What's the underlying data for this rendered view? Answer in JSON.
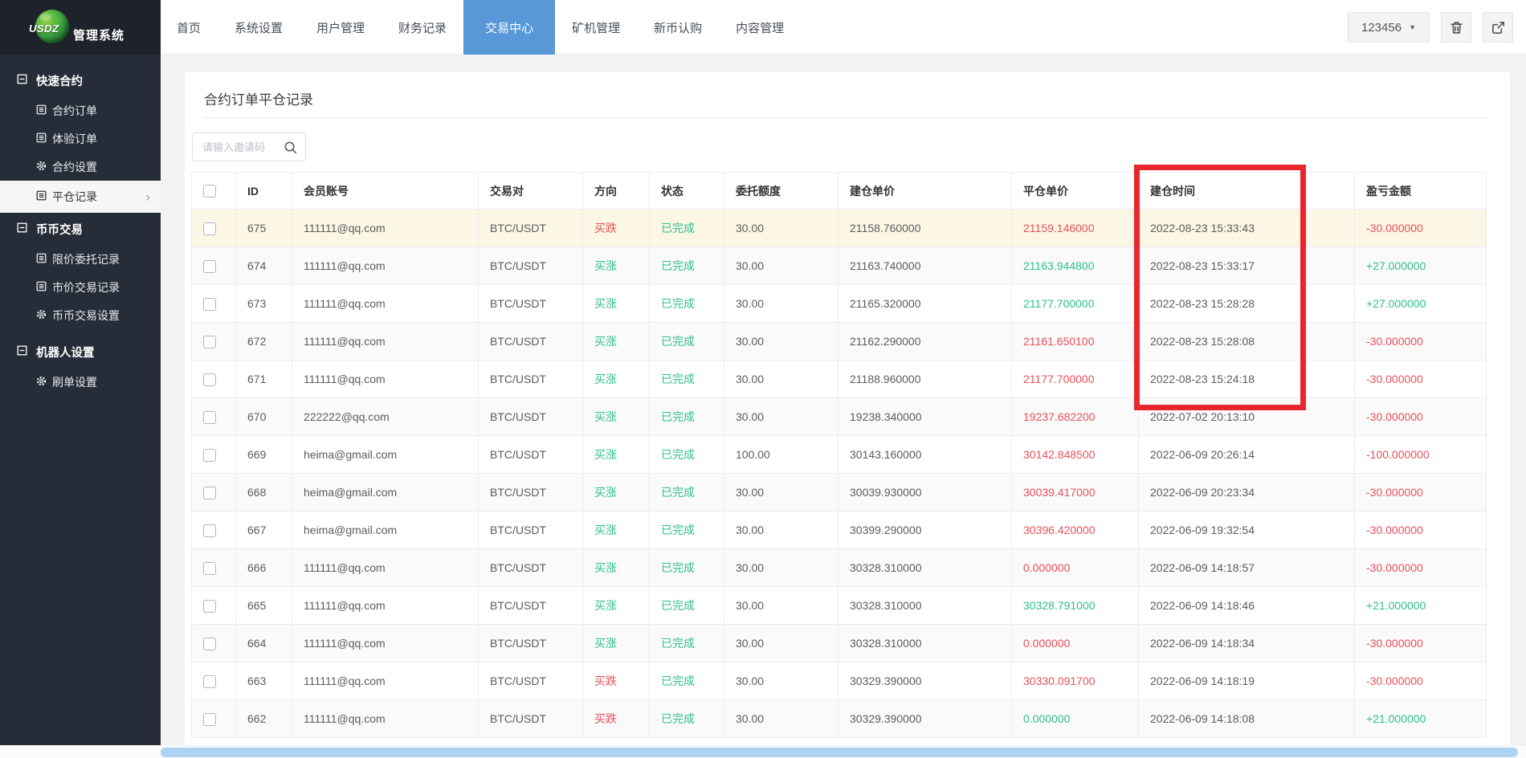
{
  "theme": {
    "accent_blue": "#5898d9",
    "red": "#e7515a",
    "green": "#2ebf8d",
    "annotation_red": "#e8262d",
    "sidebar_bg": "#272d38",
    "logo_bg": "#1e232b",
    "highlight_row": "#fcf6e5",
    "scrollbar_thumb": "#aed3f2"
  },
  "header": {
    "logo": {
      "brand": "USDZ",
      "title": "管理系统",
      "icon": "globe-icon"
    },
    "nav": [
      {
        "label": "首页",
        "active": false
      },
      {
        "label": "系统设置",
        "active": false
      },
      {
        "label": "用户管理",
        "active": false
      },
      {
        "label": "财务记录",
        "active": false
      },
      {
        "label": "交易中心",
        "active": true
      },
      {
        "label": "矿机管理",
        "active": false
      },
      {
        "label": "新币认购",
        "active": false
      },
      {
        "label": "内容管理",
        "active": false
      }
    ],
    "right": {
      "dropdown_label": "123456",
      "caret_icon": "caret-down-icon",
      "icons": [
        "trash-icon",
        "logout-icon"
      ]
    }
  },
  "sidebar": {
    "sections": [
      {
        "title": "快速合约",
        "icon": "collapse-icon",
        "items": [
          {
            "label": "合约订单",
            "icon": "list-icon",
            "active": false
          },
          {
            "label": "体验订单",
            "icon": "list-icon",
            "active": false
          },
          {
            "label": "合约设置",
            "icon": "gear-icon",
            "active": false
          },
          {
            "label": "平仓记录",
            "icon": "list-icon",
            "active": true
          }
        ]
      },
      {
        "title": "币币交易",
        "icon": "collapse-icon",
        "items": [
          {
            "label": "限价委托记录",
            "icon": "list-icon",
            "active": false
          },
          {
            "label": "市价交易记录",
            "icon": "list-icon",
            "active": false
          },
          {
            "label": "币币交易设置",
            "icon": "gear-icon",
            "active": false
          }
        ]
      },
      {
        "title": "机器人设置",
        "icon": "collapse-icon",
        "items": [
          {
            "label": "刷单设置",
            "icon": "gear-icon",
            "active": false
          }
        ]
      }
    ]
  },
  "main": {
    "page_title": "合约订单平仓记录",
    "search": {
      "placeholder": "请输入邀请码",
      "icon": "search-icon"
    },
    "table": {
      "columns": [
        "ID",
        "会员账号",
        "交易对",
        "方向",
        "状态",
        "委托额度",
        "建仓单价",
        "平仓单价",
        "建仓时间",
        "盈亏金额"
      ],
      "rows": [
        {
          "id": "675",
          "account": "111111@qq.com",
          "pair": "BTC/USDT",
          "direction": "买跌",
          "direction_color": "red",
          "status": "已完成",
          "amount": "30.00",
          "open_price": "21158.760000",
          "close_price": "21159.146000",
          "close_price_color": "red",
          "open_time": "2022-08-23 15:33:43",
          "profit": "-30.000000",
          "profit_color": "red",
          "highlight": true
        },
        {
          "id": "674",
          "account": "111111@qq.com",
          "pair": "BTC/USDT",
          "direction": "买涨",
          "direction_color": "green",
          "status": "已完成",
          "amount": "30.00",
          "open_price": "21163.740000",
          "close_price": "21163.944800",
          "close_price_color": "green",
          "open_time": "2022-08-23 15:33:17",
          "profit": "+27.000000",
          "profit_color": "green"
        },
        {
          "id": "673",
          "account": "111111@qq.com",
          "pair": "BTC/USDT",
          "direction": "买涨",
          "direction_color": "green",
          "status": "已完成",
          "amount": "30.00",
          "open_price": "21165.320000",
          "close_price": "21177.700000",
          "close_price_color": "green",
          "open_time": "2022-08-23 15:28:28",
          "profit": "+27.000000",
          "profit_color": "green"
        },
        {
          "id": "672",
          "account": "111111@qq.com",
          "pair": "BTC/USDT",
          "direction": "买涨",
          "direction_color": "green",
          "status": "已完成",
          "amount": "30.00",
          "open_price": "21162.290000",
          "close_price": "21161.650100",
          "close_price_color": "red",
          "open_time": "2022-08-23 15:28:08",
          "profit": "-30.000000",
          "profit_color": "red"
        },
        {
          "id": "671",
          "account": "111111@qq.com",
          "pair": "BTC/USDT",
          "direction": "买涨",
          "direction_color": "green",
          "status": "已完成",
          "amount": "30.00",
          "open_price": "21188.960000",
          "close_price": "21177.700000",
          "close_price_color": "red",
          "open_time": "2022-08-23 15:24:18",
          "profit": "-30.000000",
          "profit_color": "red"
        },
        {
          "id": "670",
          "account": "222222@qq.com",
          "pair": "BTC/USDT",
          "direction": "买涨",
          "direction_color": "green",
          "status": "已完成",
          "amount": "30.00",
          "open_price": "19238.340000",
          "close_price": "19237.682200",
          "close_price_color": "red",
          "open_time": "2022-07-02 20:13:10",
          "profit": "-30.000000",
          "profit_color": "red"
        },
        {
          "id": "669",
          "account": "heima@gmail.com",
          "pair": "BTC/USDT",
          "direction": "买涨",
          "direction_color": "green",
          "status": "已完成",
          "amount": "100.00",
          "open_price": "30143.160000",
          "close_price": "30142.848500",
          "close_price_color": "red",
          "open_time": "2022-06-09 20:26:14",
          "profit": "-100.000000",
          "profit_color": "red"
        },
        {
          "id": "668",
          "account": "heima@gmail.com",
          "pair": "BTC/USDT",
          "direction": "买涨",
          "direction_color": "green",
          "status": "已完成",
          "amount": "30.00",
          "open_price": "30039.930000",
          "close_price": "30039.417000",
          "close_price_color": "red",
          "open_time": "2022-06-09 20:23:34",
          "profit": "-30.000000",
          "profit_color": "red"
        },
        {
          "id": "667",
          "account": "heima@gmail.com",
          "pair": "BTC/USDT",
          "direction": "买涨",
          "direction_color": "green",
          "status": "已完成",
          "amount": "30.00",
          "open_price": "30399.290000",
          "close_price": "30396.420000",
          "close_price_color": "red",
          "open_time": "2022-06-09 19:32:54",
          "profit": "-30.000000",
          "profit_color": "red"
        },
        {
          "id": "666",
          "account": "111111@qq.com",
          "pair": "BTC/USDT",
          "direction": "买涨",
          "direction_color": "green",
          "status": "已完成",
          "amount": "30.00",
          "open_price": "30328.310000",
          "close_price": "0.000000",
          "close_price_color": "red",
          "open_time": "2022-06-09 14:18:57",
          "profit": "-30.000000",
          "profit_color": "red"
        },
        {
          "id": "665",
          "account": "111111@qq.com",
          "pair": "BTC/USDT",
          "direction": "买涨",
          "direction_color": "green",
          "status": "已完成",
          "amount": "30.00",
          "open_price": "30328.310000",
          "close_price": "30328.791000",
          "close_price_color": "green",
          "open_time": "2022-06-09 14:18:46",
          "profit": "+21.000000",
          "profit_color": "green"
        },
        {
          "id": "664",
          "account": "111111@qq.com",
          "pair": "BTC/USDT",
          "direction": "买涨",
          "direction_color": "green",
          "status": "已完成",
          "amount": "30.00",
          "open_price": "30328.310000",
          "close_price": "0.000000",
          "close_price_color": "red",
          "open_time": "2022-06-09 14:18:34",
          "profit": "-30.000000",
          "profit_color": "red"
        },
        {
          "id": "663",
          "account": "111111@qq.com",
          "pair": "BTC/USDT",
          "direction": "买跌",
          "direction_color": "red",
          "status": "已完成",
          "amount": "30.00",
          "open_price": "30329.390000",
          "close_price": "30330.091700",
          "close_price_color": "red",
          "open_time": "2022-06-09 14:18:19",
          "profit": "-30.000000",
          "profit_color": "red"
        },
        {
          "id": "662",
          "account": "111111@qq.com",
          "pair": "BTC/USDT",
          "direction": "买跌",
          "direction_color": "red",
          "status": "已完成",
          "amount": "30.00",
          "open_price": "30329.390000",
          "close_price": "0.000000",
          "close_price_color": "green",
          "open_time": "2022-06-09 14:18:08",
          "profit": "+21.000000",
          "profit_color": "green"
        }
      ]
    },
    "annotation": {
      "target_column": "建仓时间",
      "color": "#e8262d"
    }
  }
}
